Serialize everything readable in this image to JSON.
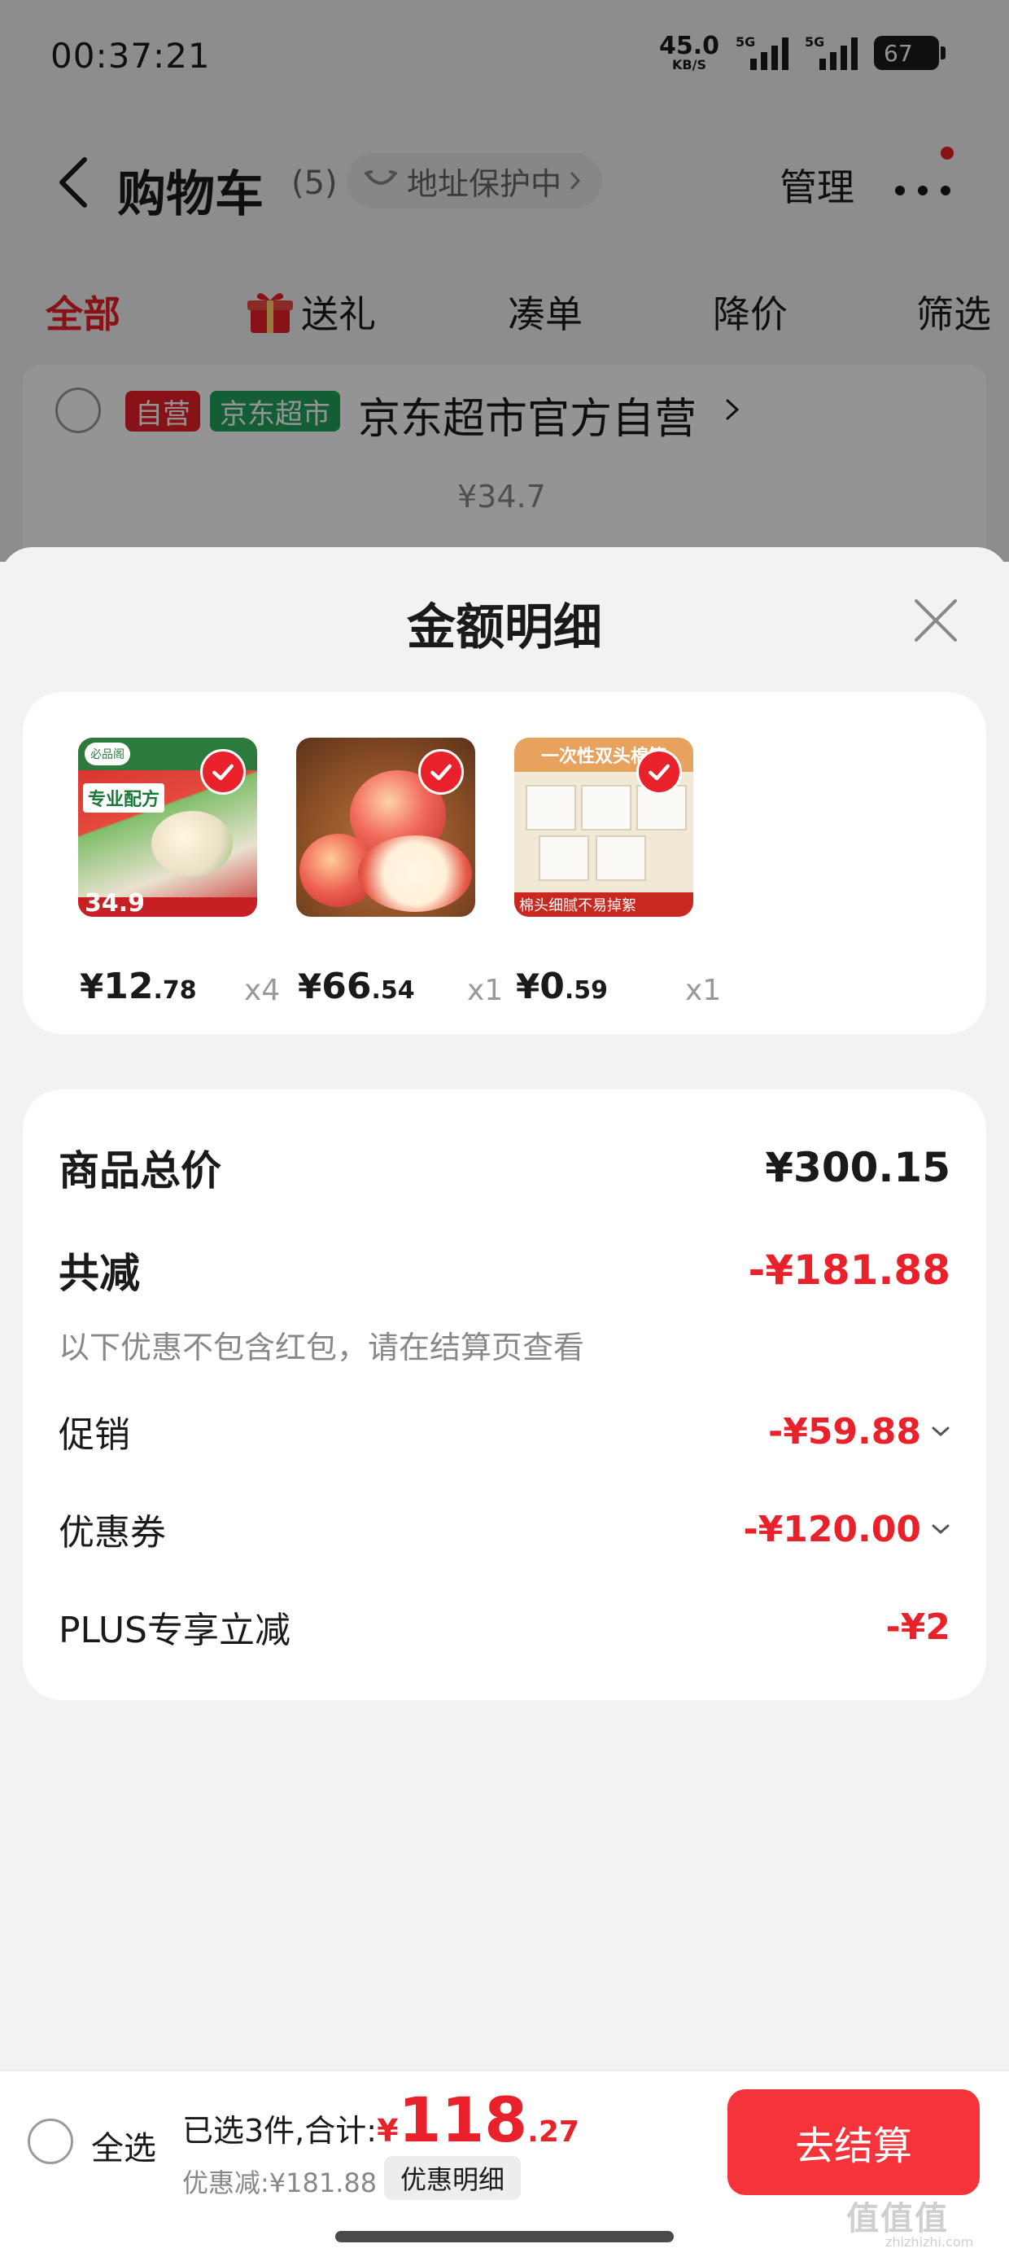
{
  "status_bar": {
    "time": "00:37:21",
    "net_speed_value": "45.0",
    "net_speed_unit": "KB/S",
    "signal1_label": "5G",
    "signal2_label": "5G",
    "battery": "67"
  },
  "nav": {
    "title": "购物车",
    "count": "(5)",
    "address_chip": "地址保护中",
    "manage": "管理"
  },
  "tabs": [
    "全部",
    "送礼",
    "凑单",
    "降价",
    "筛选"
  ],
  "store": {
    "tag_self": "自营",
    "tag_market": "京东超市",
    "name": "京东超市官方自营",
    "peek_price": "¥34.7"
  },
  "sheet": {
    "title": "金额明细",
    "items": [
      {
        "price_symbol": "¥",
        "price_int": "12",
        "price_dec": ".78",
        "qty": "x4",
        "thumb_tagline": "专业配方",
        "thumb_price": "34.9",
        "thumb_logo": "必品阁"
      },
      {
        "price_symbol": "¥",
        "price_int": "66",
        "price_dec": ".54",
        "qty": "x1"
      },
      {
        "price_symbol": "¥",
        "price_int": "0",
        "price_dec": ".59",
        "qty": "x1",
        "thumb_head": "一次性双头棉签",
        "thumb_foot": "棉头细腻不易掉絮"
      }
    ],
    "summary": {
      "total_label": "商品总价",
      "total_value": "¥300.15",
      "reduce_label": "共减",
      "reduce_value": "-¥181.88",
      "note": "以下优惠不包含红包，请在结算页查看",
      "promo_label": "促销",
      "promo_value": "-¥59.88",
      "coupon_label": "优惠券",
      "coupon_value": "-¥120.00",
      "plus_label": "PLUS专享立减",
      "plus_value": "-¥2"
    }
  },
  "footer": {
    "select_all": "全选",
    "selected_text": "已选3件,合计:",
    "total_symbol": "¥",
    "total_int": "118",
    "total_dec": ".27",
    "discount_text": "优惠减:¥181.88",
    "detail_chip": "优惠明细",
    "checkout": "去结算",
    "watermark": "值值值",
    "watermark_sub": "zhizhizhi.com"
  },
  "colors": {
    "accent_red": "#e8212a",
    "checkout_red": "#f5333a",
    "market_green": "#22a35a"
  }
}
